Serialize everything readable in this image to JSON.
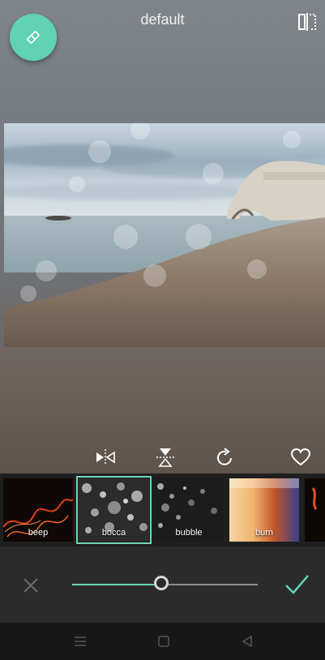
{
  "header": {
    "title": "default",
    "eraser_icon": "eraser-icon",
    "compare_icon": "split-compare-icon"
  },
  "toolbar": {
    "tools": [
      {
        "name": "flip-horizontal-icon"
      },
      {
        "name": "flip-vertical-icon"
      },
      {
        "name": "rotate-icon"
      },
      {
        "name": "favorite-heart-icon"
      }
    ]
  },
  "filters": {
    "items": [
      {
        "label": "beep",
        "selected": false
      },
      {
        "label": "bocca",
        "selected": true
      },
      {
        "label": "bubble",
        "selected": false
      },
      {
        "label": "burn",
        "selected": false
      }
    ]
  },
  "intensity": {
    "value": 0.48,
    "cancel_icon": "close-icon",
    "confirm_icon": "checkmark-icon"
  },
  "colors": {
    "accent": "#5fd3b4",
    "panel": "#2b2b2c",
    "strip": "#1f1f20"
  },
  "navigation": {
    "buttons": [
      "menu-icon",
      "home-square-icon",
      "back-triangle-icon"
    ]
  }
}
